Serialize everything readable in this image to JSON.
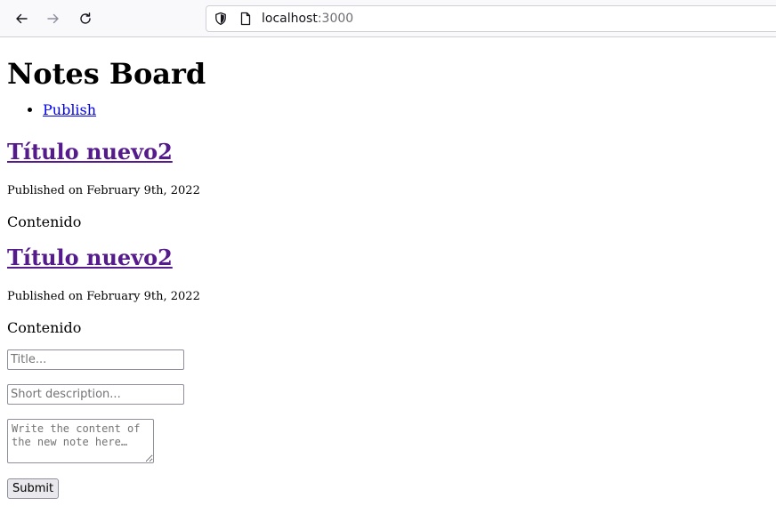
{
  "browser": {
    "url_host": "localhost",
    "url_port": ":3000"
  },
  "page": {
    "title": "Notes Board",
    "nav": [
      {
        "label": "Publish"
      }
    ]
  },
  "notes": [
    {
      "title": "Título nuevo2",
      "date": "Published on February 9th, 2022",
      "content": "Contenido"
    },
    {
      "title": "Título nuevo2",
      "date": "Published on February 9th, 2022",
      "content": "Contenido"
    }
  ],
  "form": {
    "title_placeholder": "Title...",
    "description_placeholder": "Short description...",
    "content_placeholder": "Write the content of the new note here…",
    "submit_label": "Submit"
  },
  "colors": {
    "link": "#0000ee",
    "visited_link": "#551a8b"
  }
}
